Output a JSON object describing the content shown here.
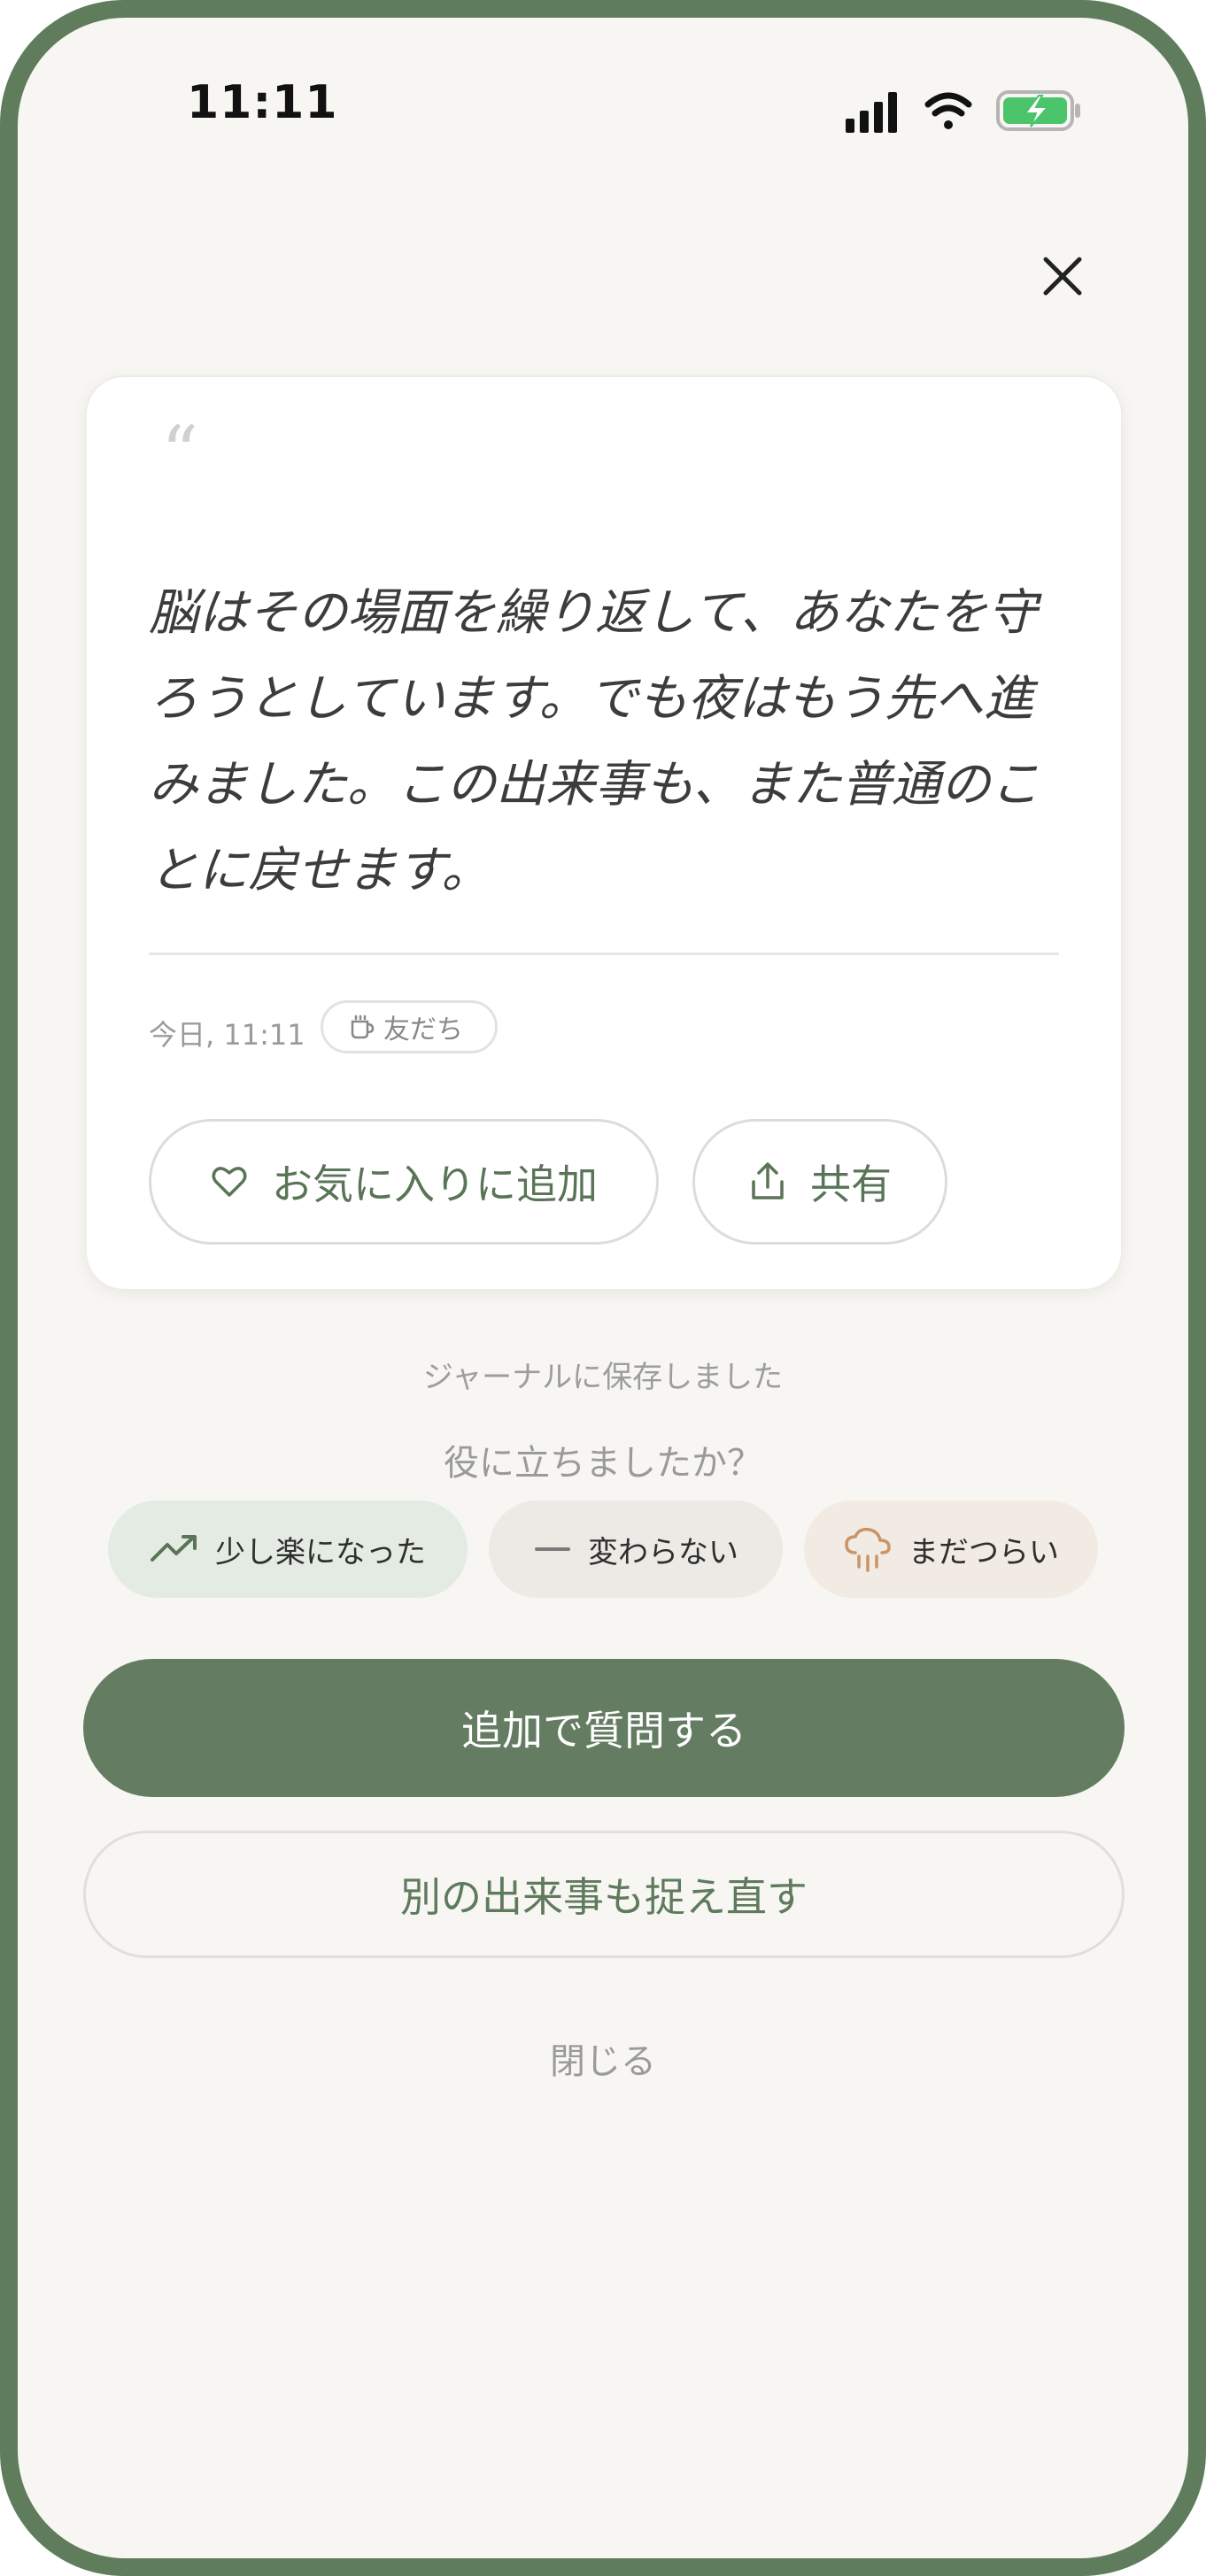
{
  "status_bar": {
    "time": "11:11",
    "icons": [
      "signal-icon",
      "wifi-icon",
      "battery-charging-icon"
    ]
  },
  "header": {
    "close_icon": "close-icon"
  },
  "card": {
    "quote_mark": "“",
    "quote_text": "脳はその場面を繰り返して、あなたを守ろうとしています。でも夜はもう先へ進みました。この出来事も、また普通のことに戻せます。",
    "timestamp": "今日, 11:11",
    "tag_label": "友だち",
    "tag_icon": "cup-icon",
    "favorite_label": "お気に入りに追加",
    "favorite_icon": "heart-icon",
    "share_label": "共有",
    "share_icon": "share-icon"
  },
  "saved_note": "ジャーナルに保存しました",
  "feedback": {
    "question": "役に立ちましたか？",
    "options": [
      {
        "label": "少し楽になった",
        "icon": "trending-up-icon"
      },
      {
        "label": "変わらない",
        "icon": "minus-icon"
      },
      {
        "label": "まだつらい",
        "icon": "rain-cloud-icon"
      }
    ]
  },
  "actions": {
    "primary_label": "追加で質問する",
    "secondary_label": "別の出来事も捉え直す",
    "close_label": "閉じる"
  },
  "colors": {
    "frame": "#5f7c5d",
    "accent": "#647d62",
    "background": "#f7f6f2",
    "battery": "#4cc46b"
  }
}
